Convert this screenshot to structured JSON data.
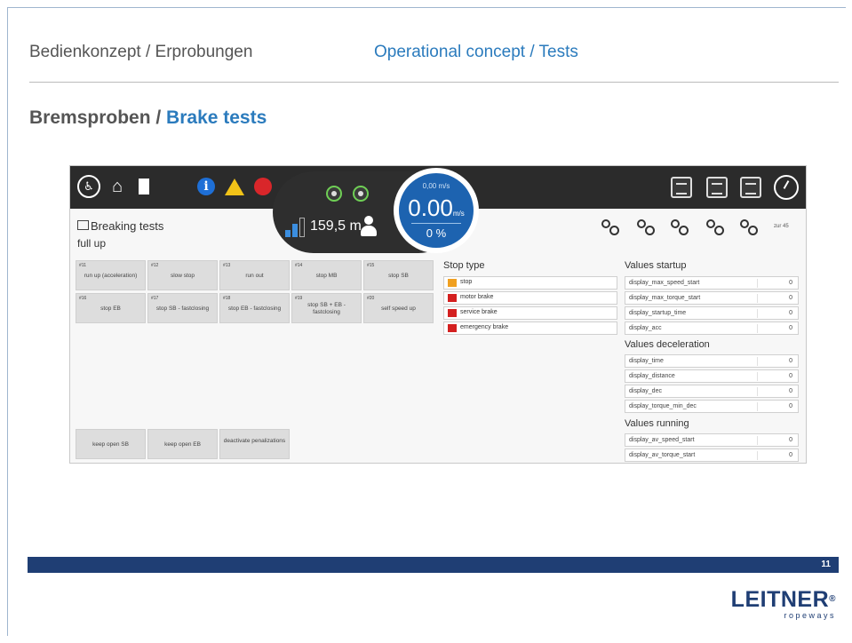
{
  "header": {
    "de": "Bedienkonzept  / Erprobungen",
    "en": "Operational concept / Tests"
  },
  "title": {
    "de": "Bremsproben / ",
    "en": "Brake tests"
  },
  "hmi": {
    "status": {
      "position": "159,5 m",
      "speed_unit": "0,00 m/s",
      "speed": "0.00",
      "speed_small": "m/s",
      "percent": "0 %"
    },
    "panel": {
      "title": "Breaking tests",
      "subtitle": "full up"
    },
    "mode": "zur 45",
    "tests": [
      {
        "num": "#11",
        "label": "run up (acceleration)"
      },
      {
        "num": "#12",
        "label": "slow stop"
      },
      {
        "num": "#13",
        "label": "run out"
      },
      {
        "num": "#14",
        "label": "stop MB"
      },
      {
        "num": "#15",
        "label": "stop SB"
      },
      {
        "num": "#16",
        "label": "stop EB"
      },
      {
        "num": "#17",
        "label": "stop SB - fastclosing"
      },
      {
        "num": "#18",
        "label": "stop EB - fastclosing"
      },
      {
        "num": "#19",
        "label": "stop SB + EB - fastclosing"
      },
      {
        "num": "#20",
        "label": "self speed up"
      }
    ],
    "bottom_buttons": [
      {
        "label": "keep open SB"
      },
      {
        "label": "keep open EB"
      },
      {
        "label": "deactivate penalizations"
      }
    ],
    "stop_type": {
      "title": "Stop type",
      "items": [
        {
          "label": "stop",
          "color": "#f0a020"
        },
        {
          "label": "motor brake",
          "color": "#d42020"
        },
        {
          "label": "service brake",
          "color": "#d42020"
        },
        {
          "label": "emergency brake",
          "color": "#d42020"
        }
      ]
    },
    "values_startup": {
      "title": "Values startup",
      "rows": [
        {
          "key": "display_max_speed_start",
          "value": "0"
        },
        {
          "key": "display_max_torque_start",
          "value": "0"
        },
        {
          "key": "display_startup_time",
          "value": "0"
        },
        {
          "key": "display_acc",
          "value": "0"
        }
      ]
    },
    "values_deceleration": {
      "title": "Values deceleration",
      "rows": [
        {
          "key": "display_time",
          "value": "0"
        },
        {
          "key": "display_distance",
          "value": "0"
        },
        {
          "key": "display_dec",
          "value": "0"
        },
        {
          "key": "display_torque_min_dec",
          "value": "0"
        }
      ]
    },
    "values_running": {
      "title": "Values running",
      "rows": [
        {
          "key": "display_av_speed_start",
          "value": "0"
        },
        {
          "key": "display_av_torque_start",
          "value": "0"
        }
      ]
    }
  },
  "footer": {
    "page": "11"
  },
  "logo": {
    "name": "LEITNER",
    "mark": "®",
    "sub": "ropeways"
  }
}
